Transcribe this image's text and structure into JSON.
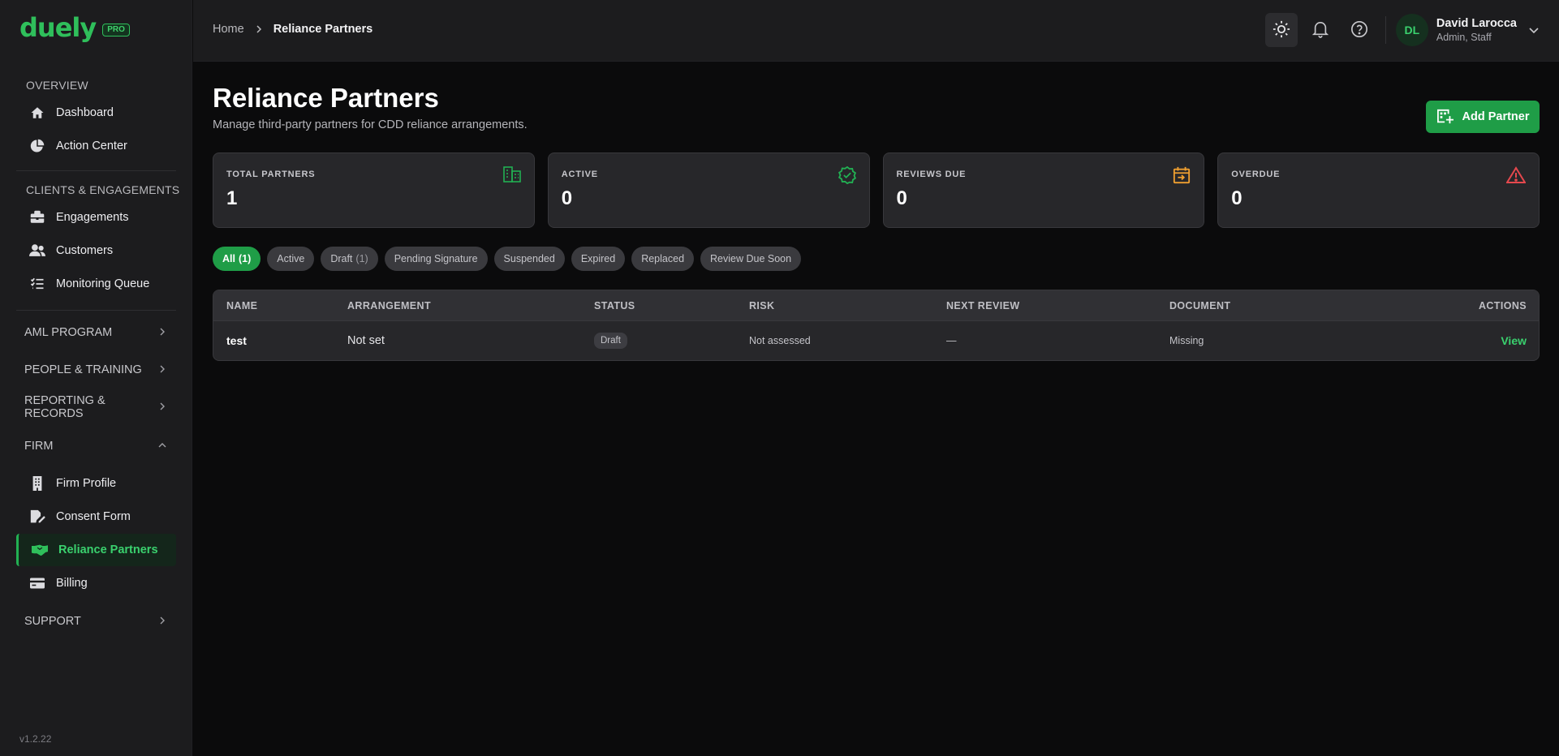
{
  "brand": {
    "name": "duely",
    "badge": "PRO"
  },
  "sidebar": {
    "overview": {
      "title": "OVERVIEW",
      "items": [
        {
          "label": "Dashboard",
          "icon": "home-icon"
        },
        {
          "label": "Action Center",
          "icon": "pie-chart-icon"
        }
      ]
    },
    "clients": {
      "title": "CLIENTS & ENGAGEMENTS",
      "items": [
        {
          "label": "Engagements",
          "icon": "briefcase-icon"
        },
        {
          "label": "Customers",
          "icon": "users-icon"
        },
        {
          "label": "Monitoring Queue",
          "icon": "list-check-icon"
        }
      ]
    },
    "groups": {
      "aml": "AML PROGRAM",
      "people": "PEOPLE & TRAINING",
      "reporting": "REPORTING & RECORDS",
      "firm": "FIRM",
      "support": "SUPPORT"
    },
    "firm_items": [
      {
        "label": "Firm Profile",
        "icon": "building-icon"
      },
      {
        "label": "Consent Form",
        "icon": "signature-icon"
      },
      {
        "label": "Reliance Partners",
        "icon": "handshake-icon",
        "active": true
      },
      {
        "label": "Billing",
        "icon": "credit-card-icon"
      }
    ],
    "version": "v1.2.22"
  },
  "topbar": {
    "breadcrumb": {
      "home": "Home",
      "current": "Reliance Partners"
    },
    "user": {
      "initials": "DL",
      "name": "David Larocca",
      "role": "Admin, Staff"
    }
  },
  "page": {
    "title": "Reliance Partners",
    "subtitle": "Manage third-party partners for CDD reliance arrangements.",
    "add_button": "Add Partner"
  },
  "stats": [
    {
      "label": "TOTAL PARTNERS",
      "value": "1",
      "icon": "building-grid-icon",
      "color": "#22b053"
    },
    {
      "label": "ACTIVE",
      "value": "0",
      "icon": "badge-check-icon",
      "color": "#22b053"
    },
    {
      "label": "REVIEWS DUE",
      "value": "0",
      "icon": "calendar-arrow-icon",
      "color": "#f0a030"
    },
    {
      "label": "OVERDUE",
      "value": "0",
      "icon": "warning-triangle-icon",
      "color": "#e5484d"
    }
  ],
  "filters": [
    {
      "label": "All",
      "count": "(1)",
      "active": true
    },
    {
      "label": "Active",
      "count": ""
    },
    {
      "label": "Draft",
      "count": "(1)"
    },
    {
      "label": "Pending Signature",
      "count": ""
    },
    {
      "label": "Suspended",
      "count": ""
    },
    {
      "label": "Expired",
      "count": ""
    },
    {
      "label": "Replaced",
      "count": ""
    },
    {
      "label": "Review Due Soon",
      "count": ""
    }
  ],
  "table": {
    "headers": [
      "NAME",
      "ARRANGEMENT",
      "STATUS",
      "RISK",
      "NEXT REVIEW",
      "DOCUMENT",
      "ACTIONS"
    ],
    "rows": [
      {
        "name": "test",
        "arrangement": "Not set",
        "status": "Draft",
        "risk": "Not assessed",
        "next_review": "—",
        "document": "Missing",
        "action": "View"
      }
    ]
  },
  "colors": {
    "accent": "#22b053",
    "background": "#0b0b0c",
    "surface": "#27272a",
    "warning": "#f0a030",
    "danger": "#e5484d"
  }
}
